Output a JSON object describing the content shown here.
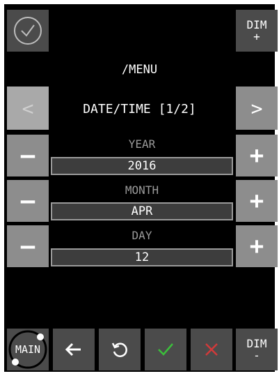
{
  "header": {
    "dim_plus_line1": "DIM",
    "dim_plus_line2": "+",
    "menu_title": "/MENU"
  },
  "page": {
    "title": "DATE/TIME [1/2]",
    "prev_glyph": "<",
    "next_glyph": ">"
  },
  "fields": {
    "year": {
      "label": "YEAR",
      "value": "2016"
    },
    "month": {
      "label": "MONTH",
      "value": "APR"
    },
    "day": {
      "label": "DAY",
      "value": "12"
    }
  },
  "footer": {
    "main_label": "MAIN",
    "dim_minus_line1": "DIM",
    "dim_minus_line2": "-"
  },
  "colors": {
    "confirm": "#3bbf3b",
    "cancel": "#d23a3a"
  }
}
